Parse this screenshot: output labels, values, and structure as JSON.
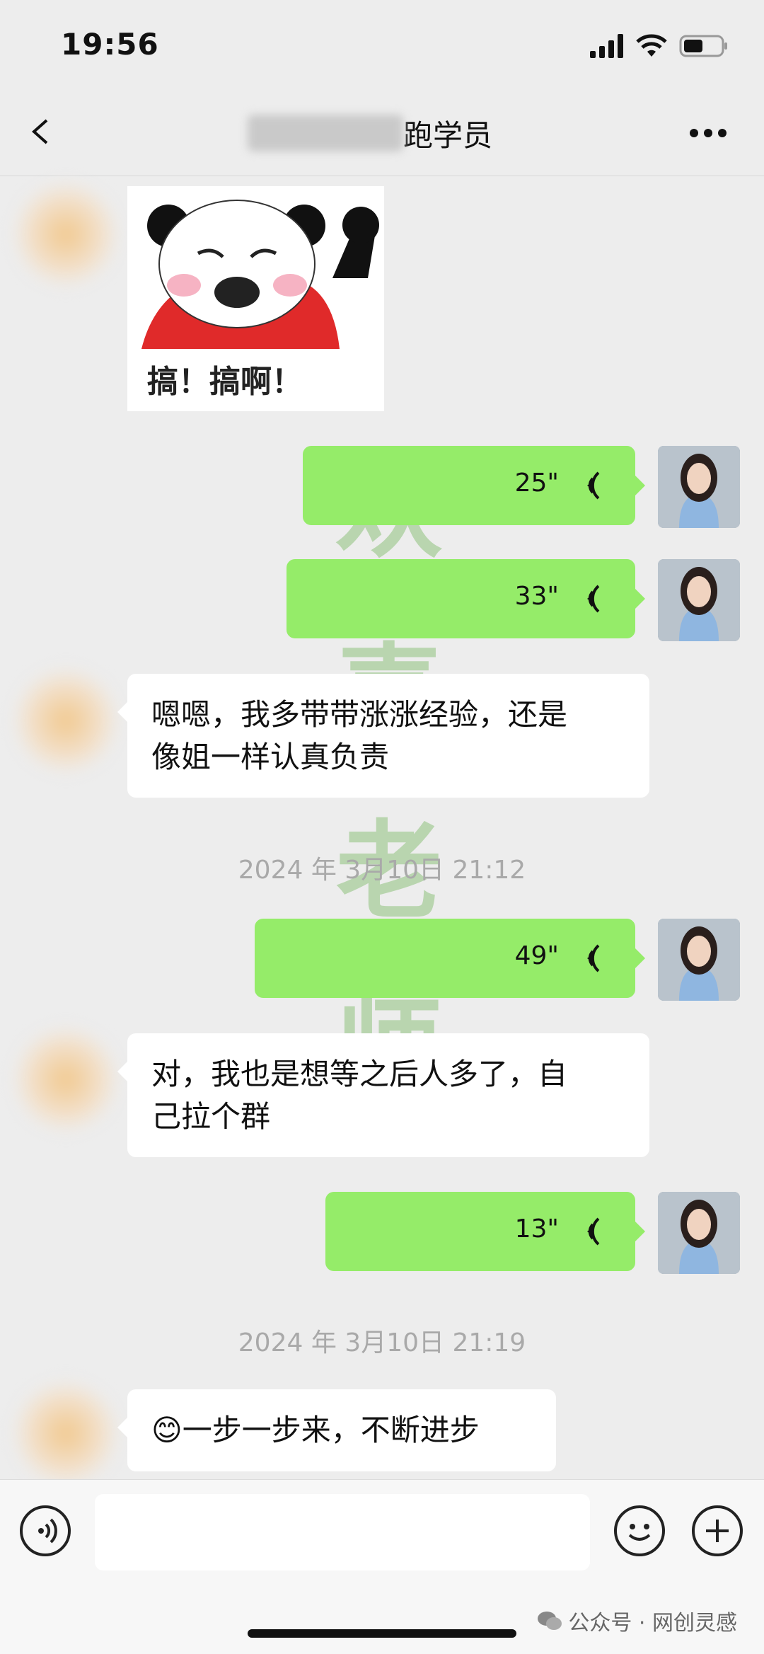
{
  "status_bar": {
    "time": "19:56"
  },
  "header": {
    "title_suffix": "跑学员"
  },
  "watermark": {
    "chars": [
      "欢",
      "喜",
      "老",
      "师"
    ]
  },
  "messages": [
    {
      "type": "sticker",
      "side": "left",
      "caption": "搞！搞啊！"
    },
    {
      "type": "voice",
      "side": "right",
      "duration": "25\""
    },
    {
      "type": "voice",
      "side": "right",
      "duration": "33\""
    },
    {
      "type": "text",
      "side": "left",
      "lines": [
        "嗯嗯，我多带带涨涨经验，还是",
        "像姐一样认真负责"
      ]
    },
    {
      "type": "timestamp",
      "text": "2024 年 3月10日 21:12"
    },
    {
      "type": "voice",
      "side": "right",
      "duration": "49\""
    },
    {
      "type": "text",
      "side": "left",
      "lines": [
        "对，我也是想等之后人多了，自",
        "己拉个群"
      ]
    },
    {
      "type": "voice",
      "side": "right",
      "duration": "13\""
    },
    {
      "type": "timestamp",
      "text": "2024 年 3月10日 21:19"
    },
    {
      "type": "text",
      "side": "left",
      "emoji": "😊",
      "lines": [
        "一步一步来，不断进步"
      ]
    }
  ],
  "footer": {
    "account_watermark": "公众号 · 网创灵感"
  }
}
